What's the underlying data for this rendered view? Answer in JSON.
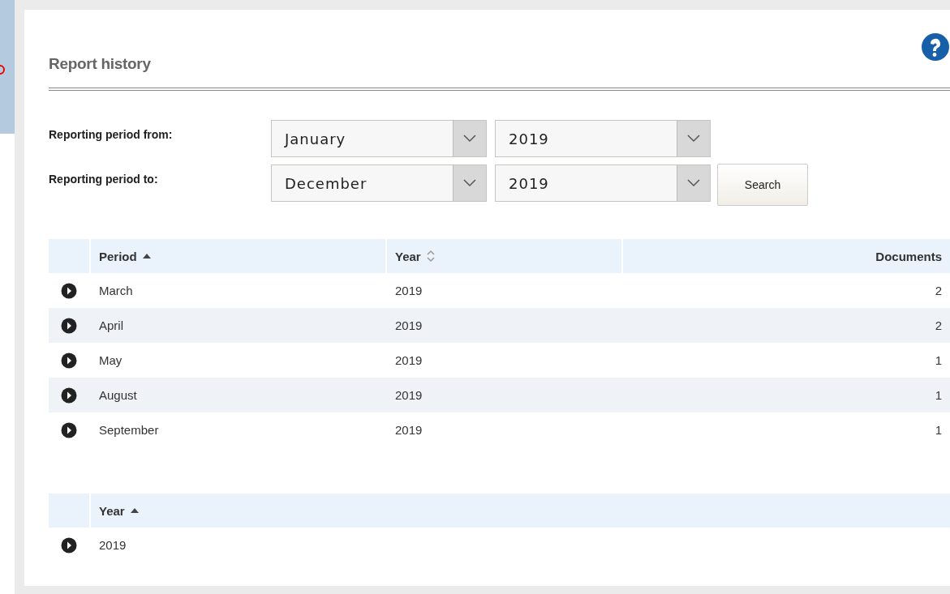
{
  "title": "Report history",
  "filters": [
    {
      "label": "Reporting period from:",
      "month": "January",
      "year": "2019"
    },
    {
      "label": "Reporting period to:",
      "month": "December",
      "year": "2019",
      "button": "Search"
    }
  ],
  "period_table": {
    "columns": [
      {
        "label": "Period",
        "sortable": true,
        "sorted": true,
        "right_aligned": false
      },
      {
        "label": "Year",
        "sortable": true,
        "sorted": false,
        "right_aligned": false
      },
      {
        "label": "Documents",
        "sortable": false,
        "right_aligned": true
      }
    ],
    "rows": [
      [
        "March",
        "2019",
        "2"
      ],
      [
        "April",
        "2019",
        "2"
      ],
      [
        "May",
        "2019",
        "1"
      ],
      [
        "August",
        "2019",
        "1"
      ],
      [
        "September",
        "2019",
        "1"
      ]
    ]
  },
  "year_table": {
    "columns": [
      {
        "label": "Year",
        "sortable": true,
        "sorted": true,
        "right_aligned": false
      }
    ],
    "rows": [
      [
        "2019"
      ]
    ]
  }
}
